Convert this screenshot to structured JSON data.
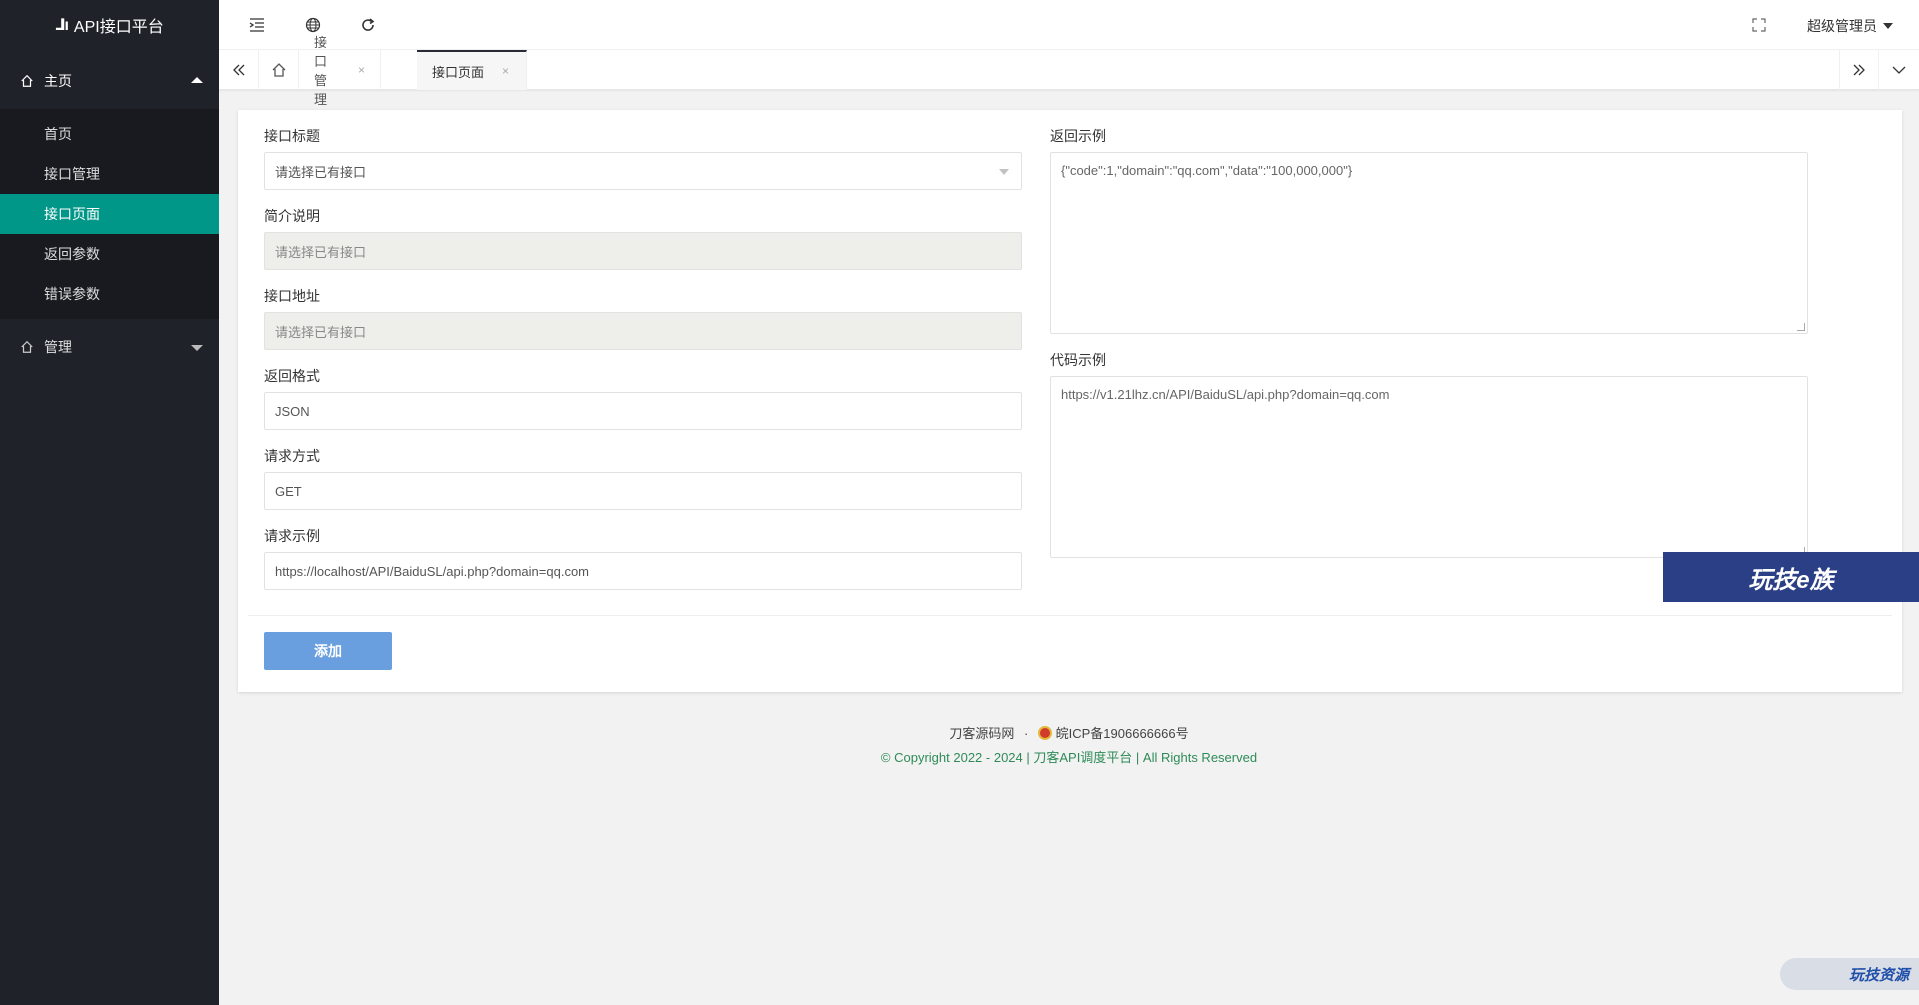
{
  "app": {
    "title": "API接口平台"
  },
  "sidebar": {
    "group_home": "主页",
    "items": [
      {
        "label": "首页",
        "active": false
      },
      {
        "label": "接口管理",
        "active": false
      },
      {
        "label": "接口页面",
        "active": true
      },
      {
        "label": "返回参数",
        "active": false
      },
      {
        "label": "错误参数",
        "active": false
      }
    ],
    "group_manage": "管理"
  },
  "header": {
    "user": "超级管理员",
    "icons": [
      "menu-fold-icon",
      "globe-icon",
      "refresh-icon",
      "fullscreen-icon"
    ]
  },
  "tabs": [
    {
      "label": "接口管理",
      "close": "×"
    },
    {
      "label": "接口页面",
      "close": "×",
      "active": true
    }
  ],
  "form": {
    "api_title_label": "接口标题",
    "api_title_value": "请选择已有接口",
    "intro_label": "简介说明",
    "intro_value": "请选择已有接口",
    "address_label": "接口地址",
    "address_value": "请选择已有接口",
    "format_label": "返回格式",
    "format_value": "JSON",
    "method_label": "请求方式",
    "method_value": "GET",
    "request_example_label": "请求示例",
    "request_example_value": "https://localhost/API/BaiduSL/api.php?domain=qq.com",
    "return_example_label": "返回示例",
    "return_example_value": "{\"code\":1,\"domain\":\"qq.com\",\"data\":\"100,000,000\"}",
    "code_example_label": "代码示例",
    "code_example_value": "https://v1.21lhz.cn/API/BaiduSL/api.php?domain=qq.com",
    "submit_label": "添加"
  },
  "watermarks": {
    "badge": "玩技e族",
    "bottom": "玩技资源"
  },
  "footer": {
    "site": "刀客源码网",
    "separator": "·",
    "icp": "皖ICP备1906666666号",
    "copyright": "© Copyright 2022 - 2024 | 刀客API调度平台 | All Rights Reserved"
  },
  "colors": {
    "sidebar_bg": "#20222a",
    "active_item": "#009688",
    "button": "#6a9fdf",
    "footer_link": "#2e8b57"
  }
}
